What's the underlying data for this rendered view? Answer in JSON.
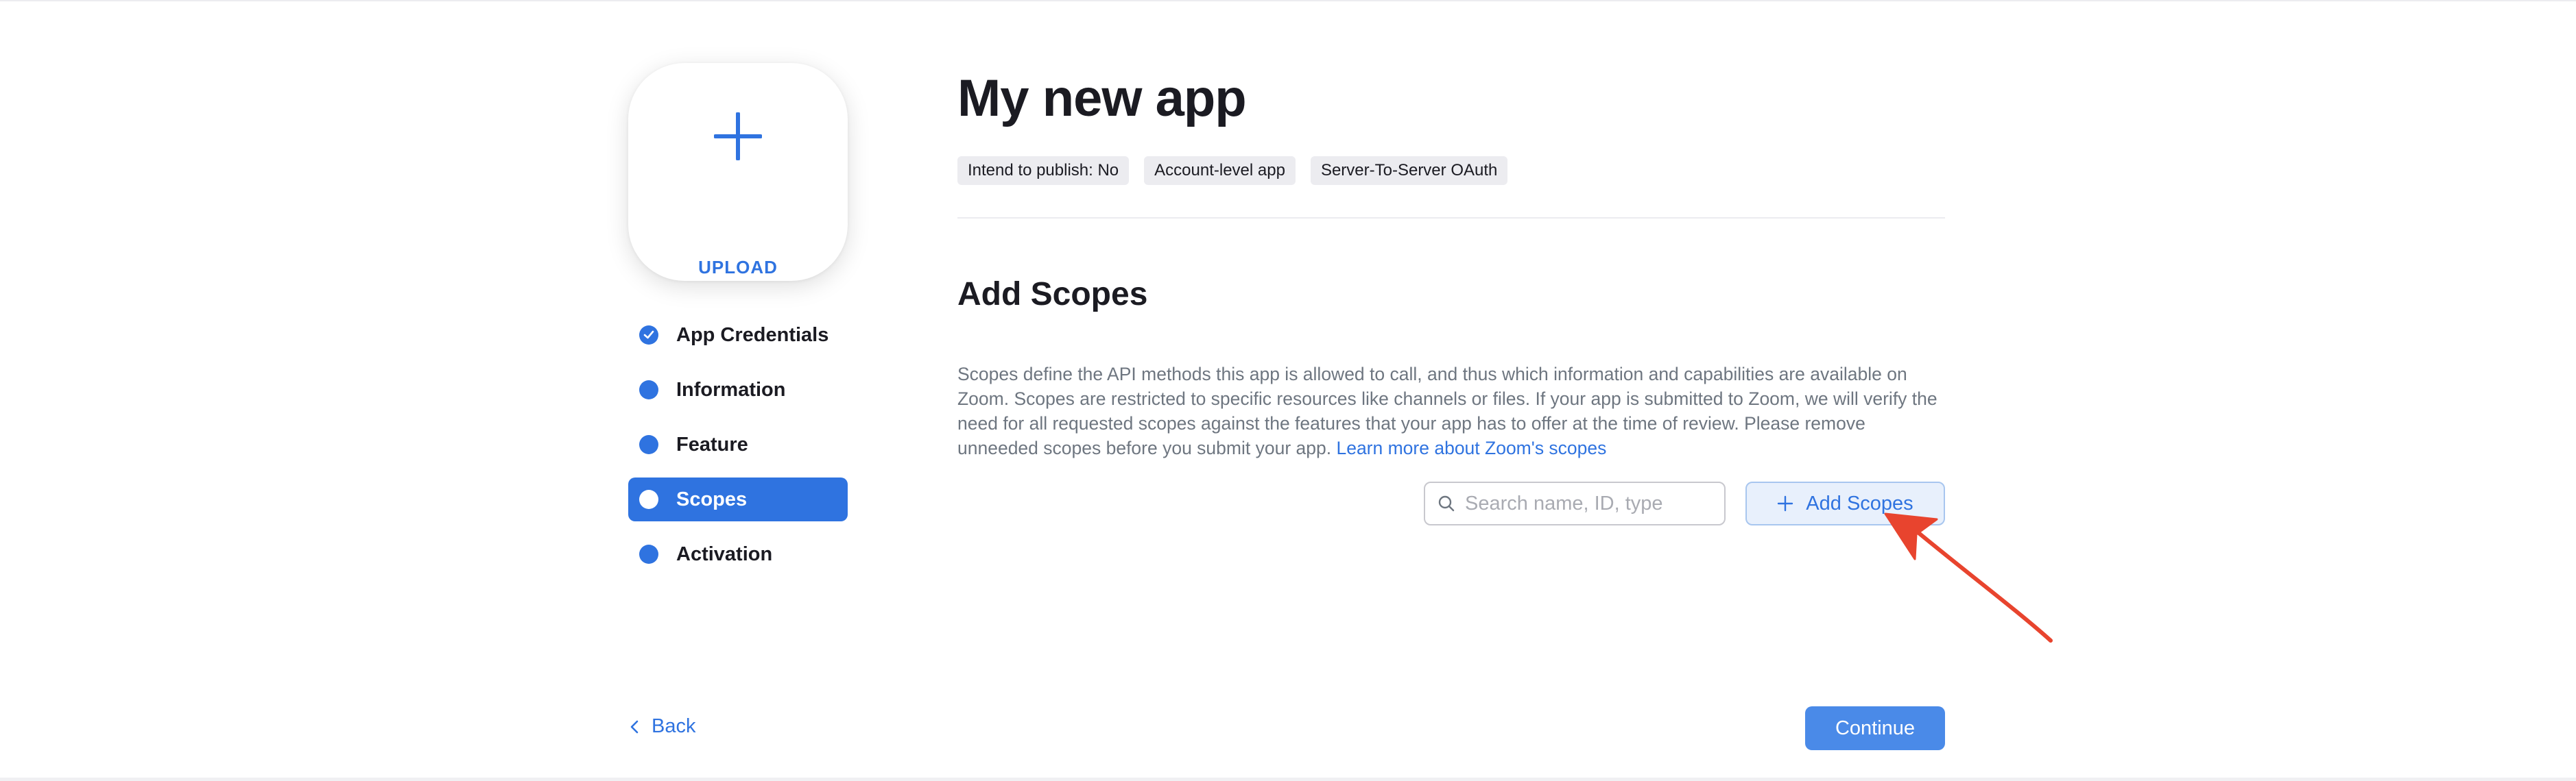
{
  "upload": {
    "label": "UPLOAD",
    "icon": "plus-icon"
  },
  "nav": {
    "items": [
      {
        "label": "App Credentials",
        "status": "completed"
      },
      {
        "label": "Information",
        "status": "pending"
      },
      {
        "label": "Feature",
        "status": "pending"
      },
      {
        "label": "Scopes",
        "status": "active"
      },
      {
        "label": "Activation",
        "status": "pending"
      }
    ]
  },
  "app": {
    "title": "My new app",
    "tags": [
      "Intend to publish: No",
      "Account-level app",
      "Server-To-Server OAuth"
    ]
  },
  "scopes": {
    "title": "Add Scopes",
    "description": "Scopes define the API methods this app is allowed to call, and thus which information and capabilities are available on Zoom. Scopes are restricted to specific resources like channels or files. If your app is submitted to Zoom, we will verify the need for all requested scopes against the features that your app has to offer at the time of review. Please remove unneeded scopes before you submit your app.",
    "learn_more_link": "Learn more about Zoom's scopes",
    "search_placeholder": "Search name, ID, type",
    "search_value": "",
    "add_button": "Add Scopes"
  },
  "footer": {
    "back_label": "Back",
    "continue_label": "Continue"
  },
  "colors": {
    "accent": "#2f73e0",
    "annotation_arrow": "#e8442e"
  }
}
